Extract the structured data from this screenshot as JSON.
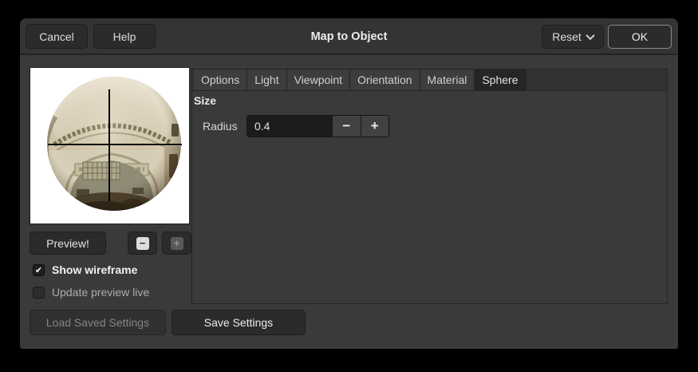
{
  "window": {
    "title": "Map to Object"
  },
  "header": {
    "cancel": "Cancel",
    "help": "Help",
    "reset": "Reset",
    "ok": "OK"
  },
  "tabs": {
    "active": "Sphere",
    "items": [
      {
        "label": "Options"
      },
      {
        "label": "Light"
      },
      {
        "label": "Viewpoint"
      },
      {
        "label": "Orientation"
      },
      {
        "label": "Material"
      },
      {
        "label": "Sphere"
      }
    ]
  },
  "sphere_page": {
    "section": "Size",
    "radius_label": "Radius",
    "radius_value": "0.4"
  },
  "preview": {
    "preview_button": "Preview!",
    "show_wireframe": "Show wireframe",
    "update_preview_live": "Update preview live",
    "wireframe_checked": true,
    "update_live_checked": false
  },
  "footer": {
    "load": "Load Saved Settings",
    "save": "Save Settings"
  },
  "icons": {
    "checkmark": "✔",
    "minus": "−",
    "plus": "+"
  },
  "colors": {
    "dialog_bg": "#3a3a3a",
    "header_bg": "#343434",
    "entry_bg": "#1c1c1c",
    "active_tab_bg": "#252525",
    "ok_border": "#8a8a8a",
    "sky_blue": "#6e93c4"
  }
}
